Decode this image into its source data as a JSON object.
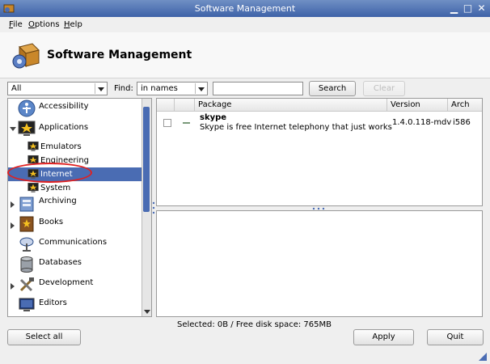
{
  "window": {
    "title": "Software Management",
    "controls": [
      "minimize-icon",
      "maximize-icon",
      "close-icon"
    ]
  },
  "menu": [
    {
      "label": "File",
      "mnemonic": "F",
      "rest": "ile"
    },
    {
      "label": "Options",
      "mnemonic": "O",
      "rest": "ptions"
    },
    {
      "label": "Help",
      "mnemonic": "H",
      "rest": "elp"
    }
  ],
  "header": {
    "title": "Software Management",
    "logo": "package-box-icon"
  },
  "filters": {
    "category": "All",
    "find_label": "Find:",
    "find_scope": "in names",
    "search_value": "",
    "search_button": "Search",
    "clear_button": "Clear"
  },
  "tree": [
    {
      "label": "Accessibility",
      "icon": "accessibility-icon",
      "expander": "none",
      "level": 0
    },
    {
      "label": "Applications",
      "icon": "star-monitor-icon",
      "expander": "expanded",
      "level": 0
    },
    {
      "label": "Emulators",
      "icon": "star-monitor-icon",
      "expander": "none",
      "level": 1
    },
    {
      "label": "Engineering",
      "icon": "star-monitor-icon",
      "expander": "none",
      "level": 1
    },
    {
      "label": "Internet",
      "icon": "star-monitor-icon",
      "expander": "none",
      "level": 1,
      "selected": true
    },
    {
      "label": "System",
      "icon": "star-monitor-icon",
      "expander": "none",
      "level": 1
    },
    {
      "label": "Archiving",
      "icon": "archive-icon",
      "expander": "collapsed",
      "level": 0
    },
    {
      "label": "Books",
      "icon": "book-icon",
      "expander": "collapsed",
      "level": 0
    },
    {
      "label": "Communications",
      "icon": "satellite-dish-icon",
      "expander": "none",
      "level": 0
    },
    {
      "label": "Databases",
      "icon": "database-icon",
      "expander": "none",
      "level": 0
    },
    {
      "label": "Development",
      "icon": "tools-icon",
      "expander": "collapsed",
      "level": 0
    },
    {
      "label": "Editors",
      "icon": "monitor-icon",
      "expander": "none",
      "level": 0
    }
  ],
  "packages": {
    "columns": [
      "",
      "",
      "Package",
      "Version",
      "Arch"
    ],
    "rows": [
      {
        "name": "skype",
        "description": "Skype is free Internet telephony that just works",
        "version": "1.4.0.118-mdv",
        "arch": "i586",
        "checked": false
      }
    ]
  },
  "status": "Selected: 0B / Free disk space: 765MB",
  "buttons": {
    "select_all": "Select all",
    "apply": "Apply",
    "quit": "Quit"
  },
  "colors": {
    "title_bar": "#4a6cb3",
    "selection": "#4a6cb3",
    "annotation": "#e02020"
  }
}
